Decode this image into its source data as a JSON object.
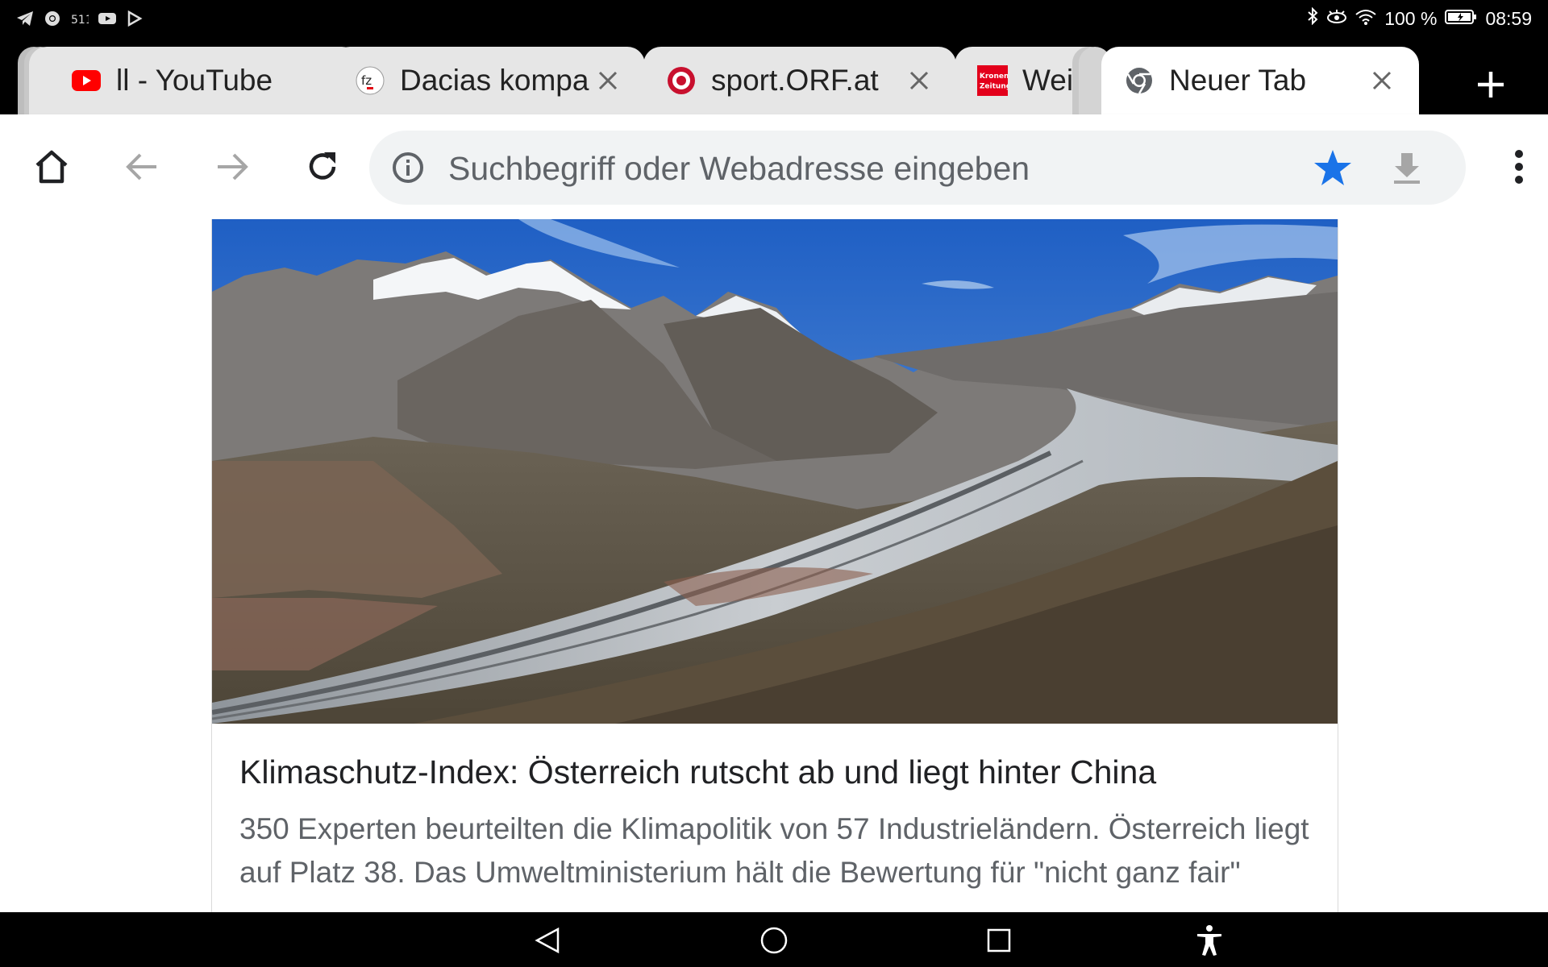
{
  "status_bar": {
    "left_icons": [
      "telegram-icon",
      "chrome-icon",
      "signal-icon",
      "youtube-icon",
      "play-store-icon"
    ],
    "battery": "100 %",
    "time": "08:59",
    "right_icons": [
      "bluetooth-icon",
      "eye-icon",
      "wifi-icon",
      "battery-icon"
    ]
  },
  "tabs": [
    {
      "title": "ll - YouTube",
      "favicon": "youtube-icon",
      "color": "#ff0000"
    },
    {
      "title": "Dacias kompa",
      "favicon": "fz-icon"
    },
    {
      "title": "sport.ORF.at",
      "favicon": "orf-icon",
      "color": "#c8102e"
    },
    {
      "title": "Weil",
      "favicon": "kronen-zeitung-icon",
      "favicon_text": "Kronen Zeitung",
      "color": "#e3001b"
    },
    {
      "title": "Neuer Tab",
      "favicon": "chrome-icon",
      "active": true
    }
  ],
  "toolbar": {
    "omnibox_placeholder": "Suchbegriff oder Webadresse eingeben",
    "bookmark_color": "#1a73e8"
  },
  "article": {
    "title": "Klimaschutz-Index: Österreich rutscht ab und liegt hinter China",
    "description": "350 Experten beurteilten die Klimapolitik von 57 Industrieländern. Österreich liegt auf Platz 38. Das Umweltministerium hält die Bewertung für \"nicht ganz fair\"",
    "image": "glacier-photo"
  },
  "nav_bar": [
    "back-icon",
    "home-icon",
    "recents-icon",
    "accessibility-icon"
  ]
}
